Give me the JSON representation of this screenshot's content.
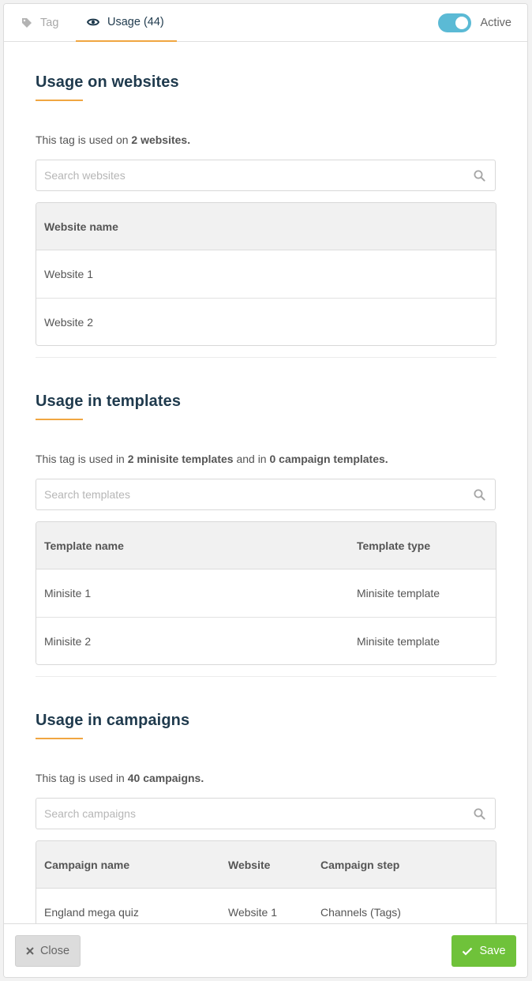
{
  "tabs": {
    "tag_label": "Tag",
    "usage_label": "Usage (44)"
  },
  "toggle": {
    "label": "Active",
    "on": true
  },
  "websites": {
    "title": "Usage on websites",
    "desc_prefix": "This tag is used on ",
    "desc_bold": "2 websites.",
    "search_placeholder": "Search websites",
    "columns": [
      "Website name"
    ],
    "rows": [
      [
        "Website 1"
      ],
      [
        "Website 2"
      ]
    ]
  },
  "templates": {
    "title": "Usage in templates",
    "desc_prefix": "This tag is used in ",
    "desc_bold1": "2 minisite templates",
    "desc_mid": " and in ",
    "desc_bold2": "0 campaign templates.",
    "search_placeholder": "Search templates",
    "columns": [
      "Template name",
      "Template type"
    ],
    "rows": [
      [
        "Minisite 1",
        "Minisite template"
      ],
      [
        "Minisite 2",
        "Minisite template"
      ]
    ]
  },
  "campaigns": {
    "title": "Usage in campaigns",
    "desc_prefix": "This tag is used in ",
    "desc_bold": "40 campaigns.",
    "search_placeholder": "Search campaigns",
    "columns": [
      "Campaign name",
      "Website",
      "Campaign step"
    ],
    "rows": [
      [
        "England mega quiz",
        "Website 1",
        "Channels (Tags)"
      ]
    ]
  },
  "footer": {
    "close_label": "Close",
    "save_label": "Save"
  },
  "colors": {
    "accent": "#f0a641",
    "toggle": "#5bbad5",
    "save": "#6fc23a",
    "title": "#1f3a4d"
  }
}
